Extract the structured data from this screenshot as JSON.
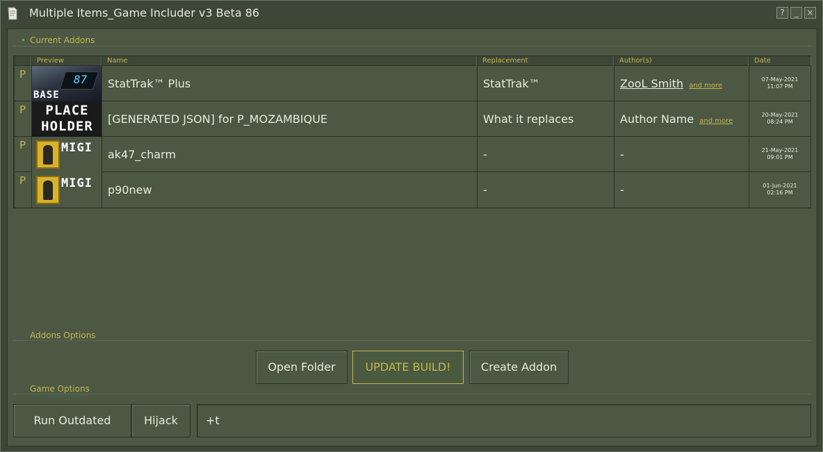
{
  "window": {
    "title": "Multiple Items_Game Includer v3 Beta 86",
    "help_button": "?",
    "minimize_button": "_",
    "close_button": "×"
  },
  "sections": {
    "current_addons": "Current Addons",
    "addons_options": "Addons Options",
    "game_options": "Game Options"
  },
  "table": {
    "headers": {
      "preview": "Preview",
      "name": "Name",
      "replacement": "Replacement",
      "authors": "Author(s)",
      "date": "Date"
    },
    "rows": [
      {
        "flag": "P",
        "preview": {
          "kind": "base",
          "digits": "87",
          "label": "BASE"
        },
        "name": "StatTrak™ Plus",
        "replacement": "StatTrak™",
        "author": "ZooL Smith",
        "more": "and more",
        "date": "07-May-2021",
        "time": "11:07 PM"
      },
      {
        "flag": "P",
        "preview": {
          "kind": "placeholder",
          "line1": "PLACE",
          "line2": "HOLDER"
        },
        "name": "[GENERATED JSON] for P_MOZAMBIQUE",
        "replacement": "What it replaces",
        "author": "Author Name",
        "more": "and more",
        "date": "20-May-2021",
        "time": "08:24 PM"
      },
      {
        "flag": "P",
        "preview": {
          "kind": "migi",
          "word": "MIGI"
        },
        "name": "ak47_charm",
        "replacement": "-",
        "author": "-",
        "date": "21-May-2021",
        "time": "09:01 PM"
      },
      {
        "flag": "P",
        "preview": {
          "kind": "migi",
          "word": "MIGI"
        },
        "name": "p90new",
        "replacement": "-",
        "author": "-",
        "date": "01-Jun-2021",
        "time": "02:16 PM"
      }
    ]
  },
  "addons_buttons": {
    "open_folder": "Open Folder",
    "update_build": "UPDATE BUILD!",
    "create_addon": "Create Addon"
  },
  "game_buttons": {
    "run_outdated": "Run Outdated",
    "hijack": "Hijack"
  },
  "launch_options": {
    "value": "+t"
  },
  "colors": {
    "background": "#3e4637",
    "panel": "#4c5844",
    "accent": "#c4b550",
    "text": "#e8e9e0"
  }
}
